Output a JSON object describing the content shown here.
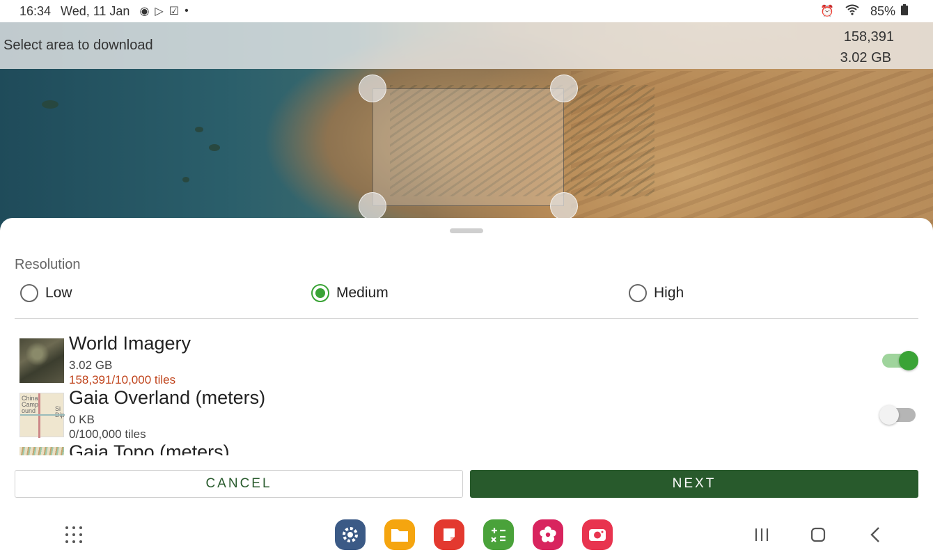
{
  "status_bar": {
    "time": "16:34",
    "date": "Wed, 11 Jan",
    "notification_icons": [
      "record-icon",
      "play-store-icon",
      "checkbox-icon",
      "dot-icon"
    ],
    "battery": "85%"
  },
  "map": {
    "header_title": "Select area to download",
    "tile_count": "158,391",
    "total_size": "3.02 GB"
  },
  "sheet": {
    "resolution_label": "Resolution",
    "resolutions": [
      {
        "label": "Low",
        "selected": false
      },
      {
        "label": "Medium",
        "selected": true
      },
      {
        "label": "High",
        "selected": false
      }
    ],
    "layers": [
      {
        "name": "World Imagery",
        "size": "3.02 GB",
        "tiles": "158,391/10,000 tiles",
        "over_limit": true,
        "enabled": true
      },
      {
        "name": "Gaia Overland (meters)",
        "size": "0 KB",
        "tiles": "0/100,000 tiles",
        "over_limit": false,
        "enabled": false,
        "thumb_labels": [
          "China Camp ound",
          "Si Dip"
        ]
      },
      {
        "name": "Gaia Topo (meters)"
      }
    ],
    "cancel_label": "CANCEL",
    "next_label": "NEXT"
  },
  "nav": {
    "dock_apps": [
      {
        "name": "settings",
        "color": "#3b5a86"
      },
      {
        "name": "my-files",
        "color": "#f5a50f"
      },
      {
        "name": "notes",
        "color": "#e3392f"
      },
      {
        "name": "calculator",
        "color": "#4aa23a"
      },
      {
        "name": "gallery",
        "color": "#d8245e"
      },
      {
        "name": "camera",
        "color": "#e8344f"
      }
    ]
  },
  "colors": {
    "accent_green": "#3aa336",
    "primary_dark_green": "#285a2c",
    "warning": "#c0441c"
  }
}
